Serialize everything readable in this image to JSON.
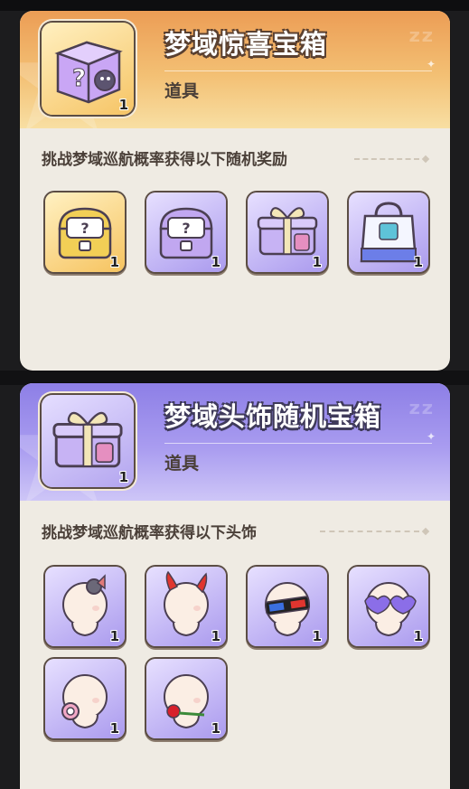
{
  "panels": [
    {
      "title": "梦域惊喜宝箱",
      "type_label": "道具",
      "main_item": {
        "icon": "purple-mystery-box-icon",
        "quantity": "1"
      },
      "section_label": "挑战梦域巡航概率获得以下随机奖励",
      "rewards": [
        {
          "icon": "gold-treasure-chest-icon",
          "quantity": "1",
          "rarity": "gold"
        },
        {
          "icon": "purple-treasure-chest-icon",
          "quantity": "1",
          "rarity": "purple"
        },
        {
          "icon": "purple-gift-box-icon",
          "quantity": "1",
          "rarity": "purple"
        },
        {
          "icon": "shopping-bag-icon",
          "quantity": "1",
          "rarity": "purple"
        }
      ]
    },
    {
      "title": "梦域头饰随机宝箱",
      "type_label": "道具",
      "main_item": {
        "icon": "purple-gift-box-icon",
        "quantity": "1"
      },
      "section_label": "挑战梦域巡航概率获得以下头饰",
      "rewards": [
        {
          "icon": "head-clip-accessory-icon",
          "quantity": "1",
          "rarity": "purple"
        },
        {
          "icon": "devil-horns-accessory-icon",
          "quantity": "1",
          "rarity": "purple"
        },
        {
          "icon": "3d-glasses-accessory-icon",
          "quantity": "1",
          "rarity": "purple"
        },
        {
          "icon": "heart-glasses-accessory-icon",
          "quantity": "1",
          "rarity": "purple"
        },
        {
          "icon": "pacifier-accessory-icon",
          "quantity": "1",
          "rarity": "purple"
        },
        {
          "icon": "rose-mouth-accessory-icon",
          "quantity": "1",
          "rarity": "purple"
        }
      ]
    }
  ],
  "colors": {
    "panel_bg": "#efebe3",
    "gold_header": "#ec9d55",
    "purple_header": "#8d7fe6",
    "gold_rarity": "#f6c35f",
    "purple_rarity": "#aa9aee",
    "outline": "#5b4d44"
  }
}
